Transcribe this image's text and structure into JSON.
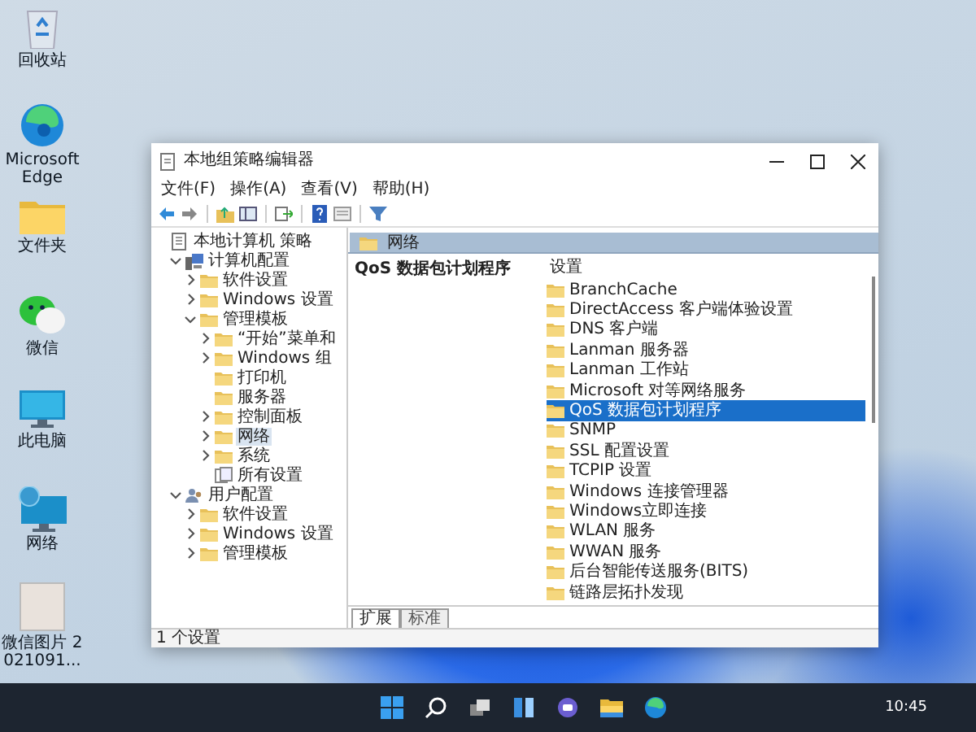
{
  "desktop_icons": [
    {
      "label": "回收站",
      "kind": "recycle"
    },
    {
      "label": "Microsoft Edge",
      "kind": "edge"
    },
    {
      "label": "文件夹",
      "kind": "folder"
    },
    {
      "label": "微信",
      "kind": "wechat"
    },
    {
      "label": "此电脑",
      "kind": "computer"
    },
    {
      "label": "网络",
      "kind": "network"
    },
    {
      "label": "微信图片 2021091...",
      "kind": "image"
    }
  ],
  "window": {
    "title": "本地组策略编辑器",
    "menu": [
      "文件(F)",
      "操作(A)",
      "查看(V)",
      "帮助(H)"
    ],
    "tree": [
      {
        "label": "本地计算机 策略",
        "kind": "policy",
        "selected": false,
        "children": [
          {
            "label": "计算机配置",
            "kind": "computer",
            "expanded": true,
            "selected": false,
            "children": [
              {
                "label": "软件设置",
                "kind": "folder",
                "expanded": false,
                "selected": false
              },
              {
                "label": "Windows 设置",
                "kind": "folder",
                "expanded": false,
                "selected": false
              },
              {
                "label": "管理模板",
                "kind": "folder",
                "expanded": true,
                "selected": false,
                "children": [
                  {
                    "label": "“开始”菜单和",
                    "kind": "folder",
                    "expanded": false,
                    "selected": false
                  },
                  {
                    "label": "Windows 组",
                    "kind": "folder",
                    "expanded": false,
                    "selected": false
                  },
                  {
                    "label": "打印机",
                    "kind": "folder",
                    "selected": false
                  },
                  {
                    "label": "服务器",
                    "kind": "folder",
                    "selected": false
                  },
                  {
                    "label": "控制面板",
                    "kind": "folder",
                    "expanded": false,
                    "selected": false
                  },
                  {
                    "label": "网络",
                    "kind": "folder",
                    "expanded": false,
                    "selected": true
                  },
                  {
                    "label": "系统",
                    "kind": "folder",
                    "expanded": false,
                    "selected": false
                  },
                  {
                    "label": "所有设置",
                    "kind": "settings",
                    "selected": false
                  }
                ]
              }
            ]
          },
          {
            "label": "用户配置",
            "kind": "user",
            "expanded": true,
            "selected": false,
            "children": [
              {
                "label": "软件设置",
                "kind": "folder",
                "expanded": false,
                "selected": false
              },
              {
                "label": "Windows 设置",
                "kind": "folder",
                "expanded": false,
                "selected": false
              },
              {
                "label": "管理模板",
                "kind": "folder",
                "expanded": false,
                "selected": false
              }
            ]
          }
        ]
      }
    ],
    "pane_header": "网络",
    "description_title": "QoS 数据包计划程序",
    "list_header": "设置",
    "list": [
      {
        "label": "BranchCache",
        "selected": false
      },
      {
        "label": "DirectAccess 客户端体验设置",
        "selected": false
      },
      {
        "label": "DNS 客户端",
        "selected": false
      },
      {
        "label": "Lanman 服务器",
        "selected": false
      },
      {
        "label": "Lanman 工作站",
        "selected": false
      },
      {
        "label": "Microsoft 对等网络服务",
        "selected": false
      },
      {
        "label": "QoS 数据包计划程序",
        "selected": true
      },
      {
        "label": "SNMP",
        "selected": false
      },
      {
        "label": "SSL 配置设置",
        "selected": false
      },
      {
        "label": "TCPIP 设置",
        "selected": false
      },
      {
        "label": "Windows 连接管理器",
        "selected": false
      },
      {
        "label": "Windows立即连接",
        "selected": false
      },
      {
        "label": "WLAN 服务",
        "selected": false
      },
      {
        "label": "WWAN 服务",
        "selected": false
      },
      {
        "label": "后台智能传送服务(BITS)",
        "selected": false
      },
      {
        "label": "链路层拓扑发现",
        "selected": false
      }
    ],
    "tabs": [
      {
        "label": "扩展",
        "selected": true
      },
      {
        "label": "标准",
        "selected": false
      }
    ],
    "status": "1 个设置"
  },
  "taskbar": {
    "clock": "10:45"
  }
}
